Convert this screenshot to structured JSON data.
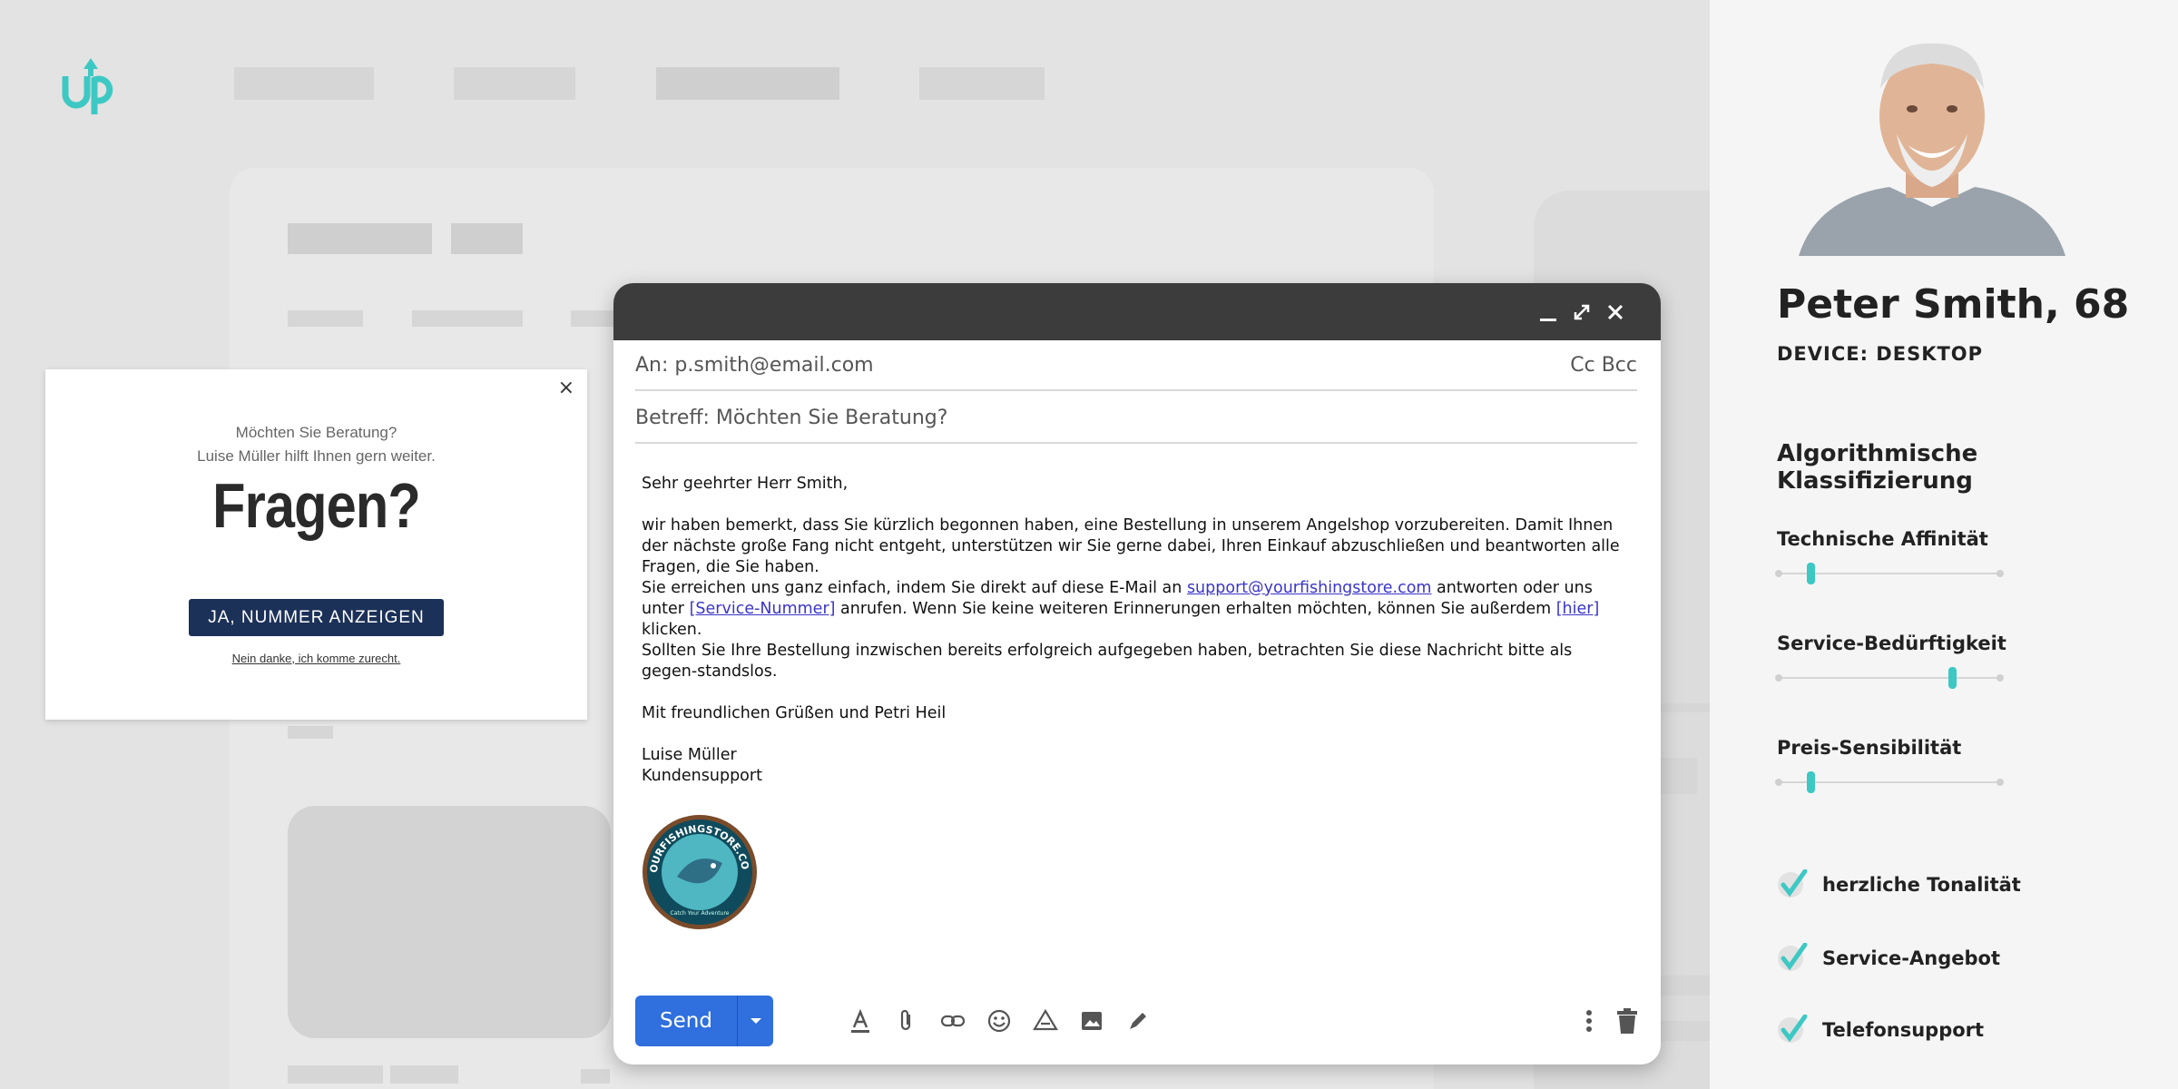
{
  "popup": {
    "line1": "Möchten Sie Beratung?",
    "line2": "Luise Müller hilft Ihnen gern weiter.",
    "headline": "Fragen?",
    "cta_label": "JA, NUMMER ANZEIGEN",
    "dismiss_label": "Nein danke, ich komme zurecht.",
    "close_glyph": "×"
  },
  "mail": {
    "to": "An: p.smith@email.com",
    "ccbcc": "Cc Bcc",
    "subject": "Betreff: Möchten Sie Beratung?",
    "greeting": "Sehr geehrter Herr Smith,",
    "para1": "wir haben bemerkt, dass Sie kürzlich begonnen haben, eine Bestellung in unserem Angelshop vorzubereiten. Damit Ihnen der nächste große Fang nicht entgeht, unterstützen wir Sie gerne dabei, Ihren Einkauf abzuschließen und beantworten alle Fragen, die Sie haben.",
    "para2_a": "Sie erreichen uns ganz einfach, indem Sie direkt auf diese E-Mail an ",
    "link_email": "support@yourfishingstore.com",
    "para2_b": " antworten oder uns unter ",
    "link_service": "[Service-Nummer]",
    "para2_c": " anrufen. Wenn Sie keine weiteren Erinnerungen erhalten möchten, können Sie außerdem ",
    "link_here": "[hier]",
    "para2_d": " klicken.",
    "para3": "Sollten Sie Ihre Bestellung inzwischen bereits erfolgreich aufgegeben haben, betrachten Sie diese Nachricht bitte als gegen-standslos.",
    "closing": "Mit freundlichen Grüßen und Petri Heil",
    "sig_name": "Luise Müller",
    "sig_role": "Kundensupport",
    "seal_text": "YOURFISHINGSTORE.COM",
    "seal_sub": "Catch Your Adventure",
    "send_label": "Send"
  },
  "profile": {
    "name": "Peter Smith, 68",
    "device": "DEVICE: DESKTOP",
    "section_title": "Algorithmische Klassifizierung",
    "metrics": [
      {
        "label": "Technische Affinität",
        "value": 0.14
      },
      {
        "label": "Service-Bedürftigkeit",
        "value": 0.79
      },
      {
        "label": "Preis-Sensibilität",
        "value": 0.14
      }
    ],
    "checks": [
      {
        "label": "herzliche Tonalität"
      },
      {
        "label": "Service-Angebot"
      },
      {
        "label": "Telefonsupport"
      }
    ]
  },
  "colors": {
    "accent": "#3ec8c4",
    "send_blue": "#2f6fde",
    "cta_navy": "#1c3158",
    "titlebar": "#3c3c3c"
  },
  "icons": [
    "up-logo-icon",
    "minimize-icon",
    "expand-icon",
    "close-icon",
    "text-format-icon",
    "attach-icon",
    "link-icon",
    "emoji-icon",
    "drive-icon",
    "image-icon",
    "signature-pen-icon",
    "more-options-icon",
    "trash-icon",
    "chevron-down-icon",
    "check-icon"
  ]
}
